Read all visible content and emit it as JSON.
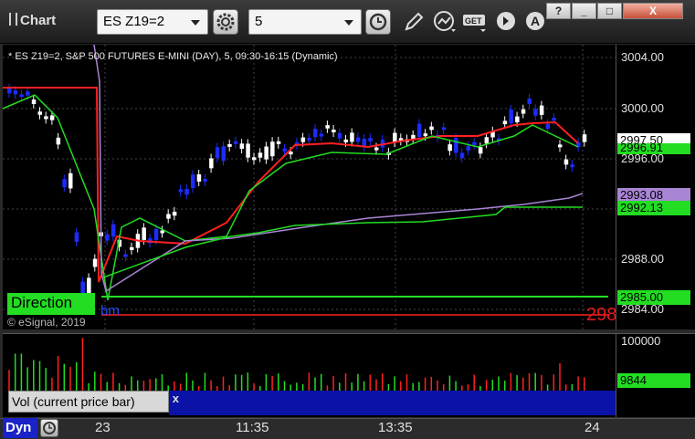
{
  "titlebar": {
    "app_title": "Chart",
    "symbol": "ES Z19=2",
    "interval": "5",
    "window_buttons": [
      "?",
      "_",
      "□",
      "X"
    ]
  },
  "chart": {
    "study_label": "* ES Z19=2, S&P 500 FUTURES E-MINI (DAY), 5, 09:30-16:15 (Dynamic)",
    "direction_label": "Direction",
    "copyright": "© eSignal, 2019",
    "partial_text": "bm",
    "partial_price": "298",
    "price_ticks": [
      "3004.00",
      "3000.00",
      "2996.00",
      "2988.00",
      "2984.00"
    ],
    "price_tags": [
      {
        "label": "2997.50",
        "bg": "#ffffff",
        "fg": "#000000"
      },
      {
        "label": "2996.91",
        "bg": "#22dd22",
        "fg": "#000000"
      },
      {
        "label": "2993.08",
        "bg": "#a985d6",
        "fg": "#000000"
      },
      {
        "label": "2992.13",
        "bg": "#22dd22",
        "fg": "#000000"
      },
      {
        "label": "2985.00",
        "bg": "#22dd22",
        "fg": "#000000"
      }
    ],
    "colors": {
      "up_candle": "#ffffff",
      "down_candle": "#1c2cff",
      "red_ma": "#ff2020",
      "green_ma": "#22dd22",
      "purple_ma": "#a985d6"
    }
  },
  "volume": {
    "panel_label": "Vol (current price bar)",
    "close_symbol": "x",
    "ticks": [
      "100000"
    ],
    "current_tag": "9844"
  },
  "bottombar": {
    "dyn_label": "Dyn",
    "time_labels": [
      "23",
      "11:35",
      "13:35",
      "24"
    ]
  }
}
